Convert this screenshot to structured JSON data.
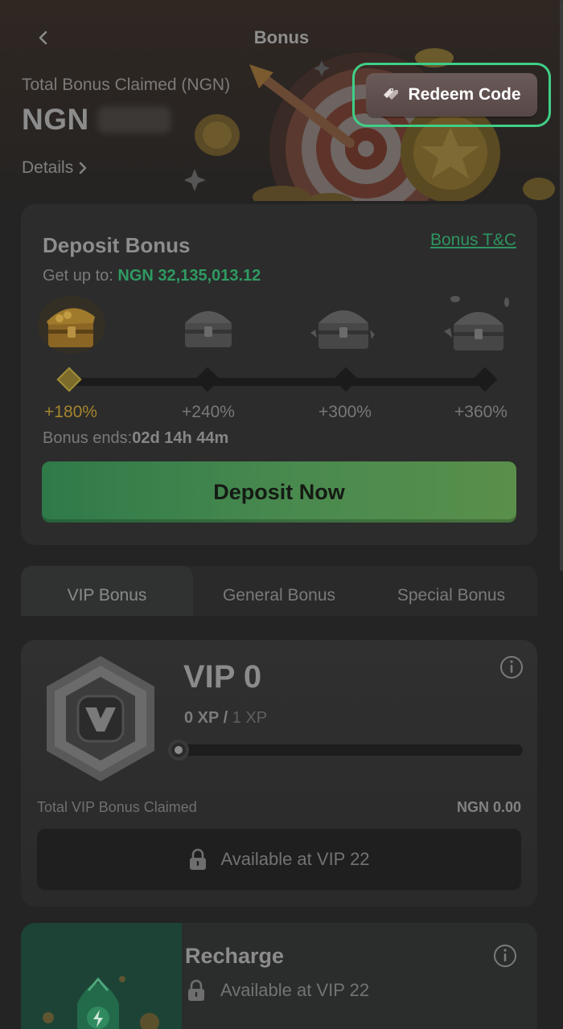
{
  "header": {
    "title": "Bonus",
    "back_icon": "chevron-left-icon"
  },
  "summary": {
    "total_label": "Total Bonus Claimed (NGN)",
    "currency": "NGN",
    "details_label": "Details"
  },
  "redeem": {
    "label": "Redeem Code",
    "icon": "tag-icon",
    "highlight_color": "#3fcf87"
  },
  "deposit": {
    "title": "Deposit Bonus",
    "tc_label": "Bonus T&C",
    "getup_label": "Get up to:",
    "getup_amount": "NGN 32,135,013.12",
    "tiers": [
      {
        "label": "+180%",
        "active": true
      },
      {
        "label": "+240%",
        "active": false
      },
      {
        "label": "+300%",
        "active": false
      },
      {
        "label": "+360%",
        "active": false
      }
    ],
    "ends_label": "Bonus ends:",
    "ends_value": "02d 14h 44m",
    "cta_label": "Deposit Now",
    "accent_color": "#2f9a62"
  },
  "tabs": [
    {
      "label": "VIP Bonus",
      "active": true
    },
    {
      "label": "General Bonus",
      "active": false
    },
    {
      "label": "Special Bonus",
      "active": false
    }
  ],
  "vip": {
    "level": "VIP 0",
    "xp_current": "0 XP",
    "xp_separator": "/",
    "xp_target": "1 XP",
    "progress": 0,
    "total_label": "Total VIP Bonus Claimed",
    "total_value": "NGN 0.00",
    "locked_label": "Available at VIP 22"
  },
  "recharge": {
    "title": "Recharge",
    "locked_label": "Available at VIP 22"
  }
}
